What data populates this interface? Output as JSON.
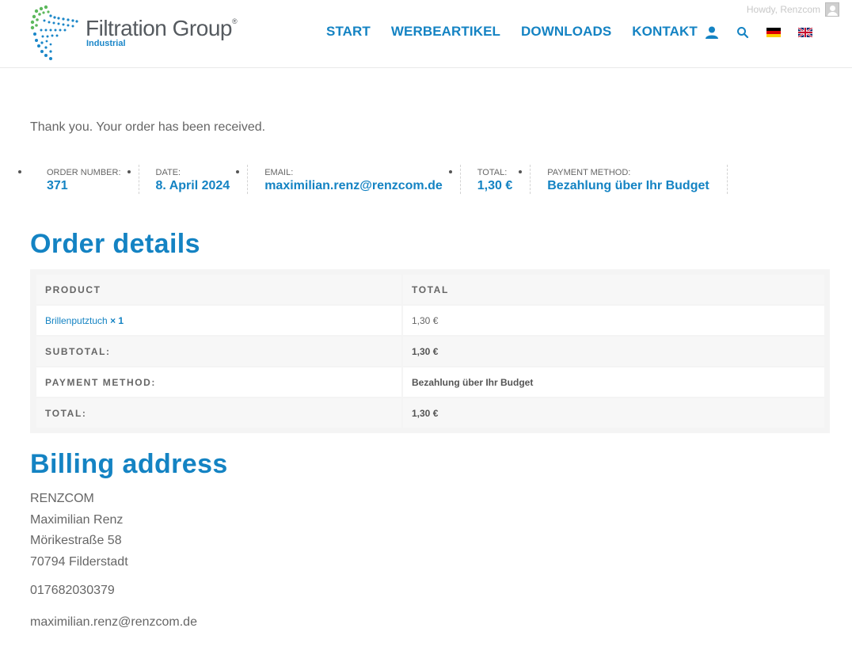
{
  "adminbar": {
    "greeting": "Howdy, Renzcom"
  },
  "brand": {
    "name": "Filtration Group",
    "registered": "®",
    "sub": "Industrial",
    "colors": {
      "blue": "#1483c3",
      "green": "#5cb85c",
      "grey": "#555a5f"
    }
  },
  "nav": {
    "items": [
      {
        "label": "START"
      },
      {
        "label": "WERBEARTIKEL"
      },
      {
        "label": "DOWNLOADS"
      },
      {
        "label": "KONTAKT"
      }
    ],
    "icons": [
      "user-account-icon",
      "search-icon",
      "flag-de-icon",
      "flag-uk-icon"
    ]
  },
  "order": {
    "thank_you": "Thank you. Your order has been received.",
    "overview": {
      "number_label": "ORDER NUMBER:",
      "number": "371",
      "date_label": "DATE:",
      "date": "8. April 2024",
      "email_label": "EMAIL:",
      "email": "maximilian.renz@renzcom.de",
      "total_label": "TOTAL:",
      "total": "1,30 €",
      "payment_label": "PAYMENT METHOD:",
      "payment": "Bezahlung über Ihr Budget"
    },
    "details_title": "Order details",
    "table": {
      "col_product": "PRODUCT",
      "col_total": "TOTAL",
      "item_name": "Brillenputztuch",
      "item_qty": "× 1",
      "item_total": "1,30 €",
      "subtotal_label": "SUBTOTAL:",
      "subtotal": "1,30 €",
      "payment_label": "PAYMENT METHOD:",
      "payment": "Bezahlung über Ihr Budget",
      "total_label": "TOTAL:",
      "total": "1,30 €"
    }
  },
  "billing": {
    "title": "Billing address",
    "company": "RENZCOM",
    "name": "Maximilian Renz",
    "street": "Mörikestraße 58",
    "city": "70794 Filderstadt",
    "phone": "017682030379",
    "email": "maximilian.renz@renzcom.de"
  }
}
